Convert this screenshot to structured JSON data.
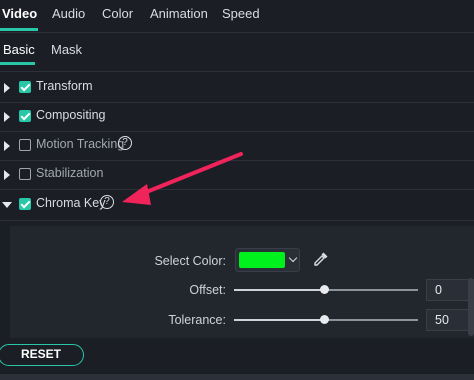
{
  "tabs": [
    "Video",
    "Audio",
    "Color",
    "Animation",
    "Speed"
  ],
  "subtabs": [
    "Basic",
    "Mask"
  ],
  "sections": [
    {
      "label": "Transform",
      "checked": true,
      "expanded": false,
      "help": false
    },
    {
      "label": "Compositing",
      "checked": true,
      "expanded": false,
      "help": false
    },
    {
      "label": "Motion Tracking",
      "checked": false,
      "expanded": false,
      "help": true
    },
    {
      "label": "Stabilization",
      "checked": false,
      "expanded": false,
      "help": false
    },
    {
      "label": "Chroma Key",
      "checked": true,
      "expanded": true,
      "help": true
    }
  ],
  "help_icon": "?",
  "chroma_key": {
    "select_color_label": "Select Color:",
    "selected_color": "#00f01e",
    "eyedropper_icon": "eyedropper-icon",
    "offset_label": "Offset:",
    "offset_value": "0",
    "offset_fraction": 0.49,
    "tolerance_label": "Tolerance:",
    "tolerance_value": "50",
    "tolerance_fraction": 0.49
  },
  "reset_label": "RESET",
  "colors": {
    "accent": "#27c7a8",
    "annotation_arrow": "#f0245a"
  }
}
